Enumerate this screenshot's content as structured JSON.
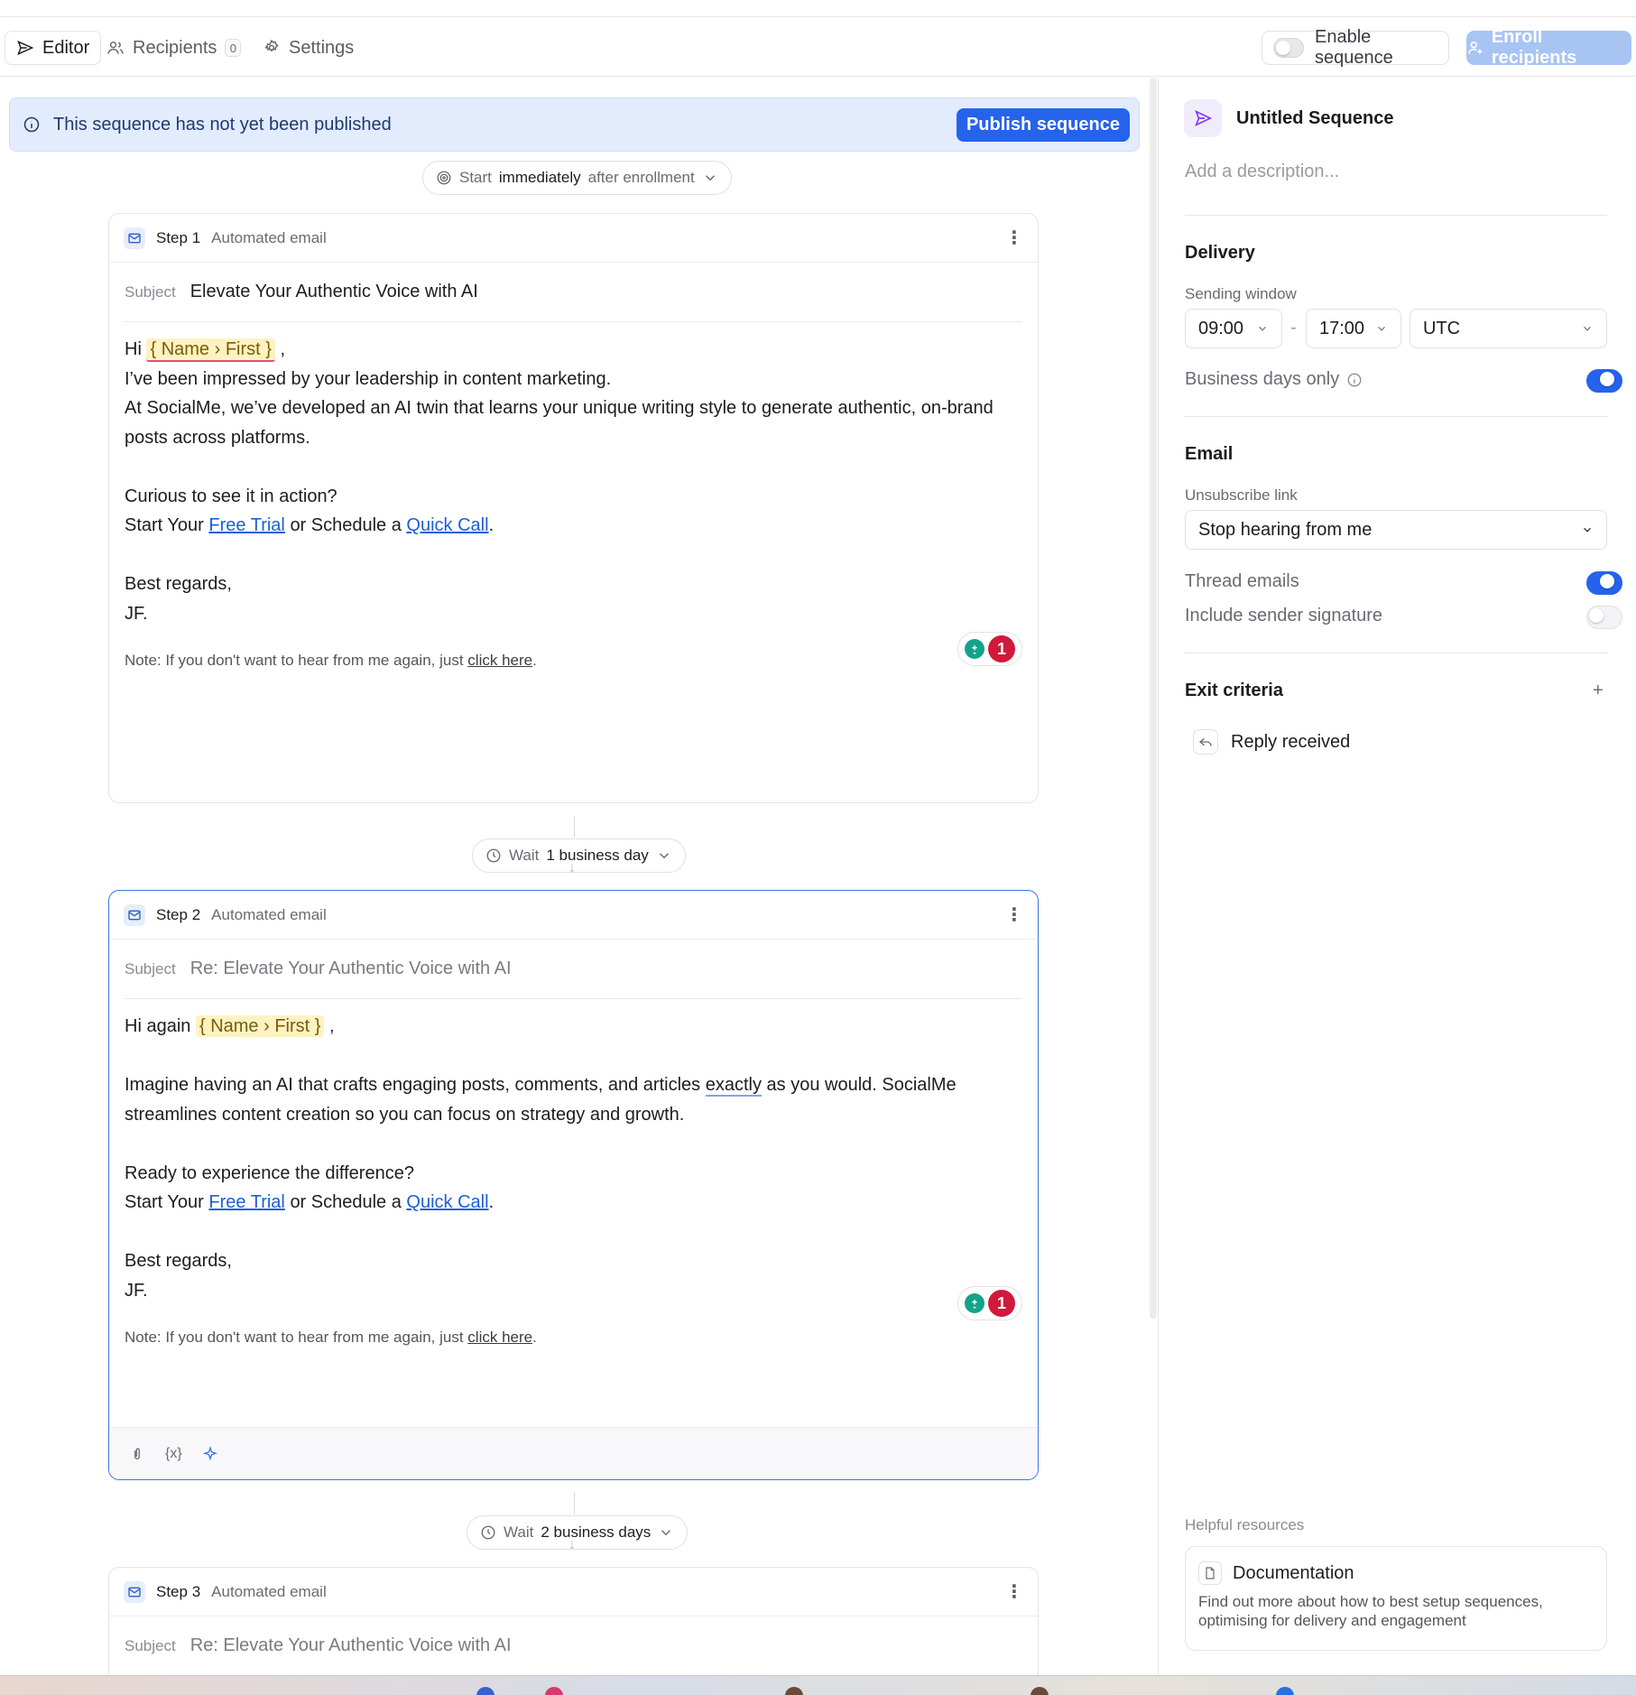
{
  "toolbar": {
    "tabs": [
      {
        "label": "Editor",
        "icon": "send-icon",
        "active": true
      },
      {
        "label": "Recipients",
        "icon": "users-icon",
        "badge": "0"
      },
      {
        "label": "Settings",
        "icon": "gear-icon"
      }
    ],
    "enable_sequence_label": "Enable sequence",
    "enroll_label": "Enroll recipients"
  },
  "banner": {
    "text": "This sequence has not yet been published",
    "publish_label": "Publish sequence"
  },
  "start_pill": {
    "prefix": "Start",
    "strong": "immediately",
    "suffix": "after enrollment"
  },
  "steps": [
    {
      "step_label": "Step 1",
      "type_label": "Automated email",
      "subject_label": "Subject",
      "subject": "Elevate Your Authentic Voice with AI",
      "greeting": "Hi",
      "variable": "{ Name › First }",
      "greeting_end": ",",
      "lines": [
        "I’ve been impressed by your leadership in content marketing.",
        "At SocialMe, we’ve developed an AI twin that learns your unique writing style to generate authentic, on-brand posts across platforms.",
        "Curious to see it in action?"
      ],
      "cta_prefix": "Start Your",
      "cta_link1": "Free Trial",
      "cta_mid": "or Schedule a",
      "cta_link2": "Quick Call",
      "cta_end": ".",
      "signoff": "Best regards,",
      "signature": "JF.",
      "grammar_count": "1",
      "note_prefix": "Note: If you don't want to hear from me again, just",
      "note_link": "click here",
      "note_end": "."
    },
    {
      "step_label": "Step 2",
      "type_label": "Automated email",
      "subject_label": "Subject",
      "subject": "Re: Elevate Your Authentic Voice with AI",
      "greeting": "Hi again",
      "variable": "{ Name › First }",
      "greeting_end": ",",
      "line1_before": "Imagine having an AI that crafts engaging posts, comments, and articles",
      "line1_word": "exactly",
      "line1_after": "as you would. SocialMe streamlines content creation so you can focus on strategy and growth.",
      "line2": "Ready to experience the difference?",
      "cta_prefix": "Start Your",
      "cta_link1": "Free Trial",
      "cta_mid": "or Schedule a",
      "cta_link2": "Quick Call",
      "cta_end": ".",
      "signoff": "Best regards,",
      "signature": "JF.",
      "grammar_count": "1",
      "note_prefix": "Note: If you don't want to hear from me again, just",
      "note_link": "click here",
      "note_end": ".",
      "footer_icons": [
        "paperclip-icon",
        "variable-braces-icon",
        "sparkle-icon"
      ]
    },
    {
      "step_label": "Step 3",
      "type_label": "Automated email",
      "subject_label": "Subject",
      "subject": "Re: Elevate Your Authentic Voice with AI"
    }
  ],
  "waits": [
    {
      "prefix": "Wait",
      "strong": "1 business day"
    },
    {
      "prefix": "Wait",
      "strong": "2 business days"
    }
  ],
  "sidebar": {
    "title": "Untitled Sequence",
    "description_placeholder": "Add a description...",
    "delivery": {
      "title": "Delivery",
      "sending_window_label": "Sending window",
      "start_time": "09:00",
      "dash": "-",
      "end_time": "17:00",
      "timezone": "UTC",
      "business_days_label": "Business days only",
      "business_days_on": true
    },
    "email": {
      "title": "Email",
      "unsubscribe_label": "Unsubscribe link",
      "unsubscribe_value": "Stop hearing from me",
      "thread_label": "Thread emails",
      "thread_on": true,
      "signature_label": "Include sender signature",
      "signature_on": false
    },
    "exit": {
      "title": "Exit criteria",
      "add_symbol": "+",
      "item": "Reply received"
    },
    "help": {
      "title": "Helpful resources",
      "doc_title": "Documentation",
      "doc_text": "Find out more about how to best setup sequences, optimising for delivery and engagement"
    }
  },
  "colors": {
    "accent": "#2563eb",
    "banner_bg": "#e3ecfd",
    "variable_bg": "#fdf2c4",
    "error": "#d11a3b",
    "grammar": "#13a38a"
  }
}
